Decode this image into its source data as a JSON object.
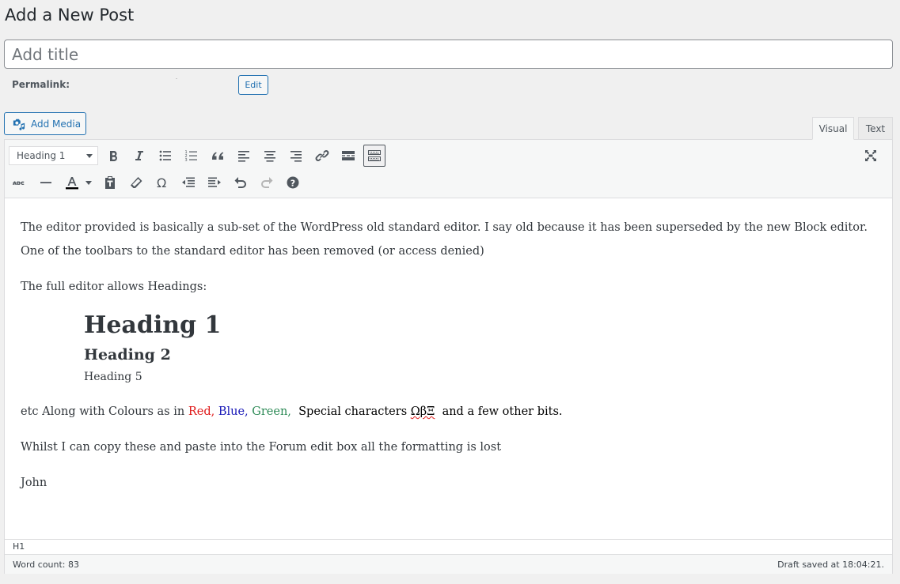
{
  "page": {
    "title": "Add a New Post"
  },
  "title_field": {
    "placeholder": "Add title",
    "value": ""
  },
  "permalink": {
    "label": "Permalink:",
    "edit_label": "Edit"
  },
  "media": {
    "add_media_label": "Add Media",
    "icon": "add-media-icon"
  },
  "editor_tabs": [
    {
      "label": "Visual",
      "active": true
    },
    {
      "label": "Text",
      "active": false
    }
  ],
  "toolbar": {
    "format_select": {
      "value": "Heading 1"
    },
    "row1": [
      {
        "name": "bold",
        "icon": "bold-icon"
      },
      {
        "name": "italic",
        "icon": "italic-icon"
      },
      {
        "name": "bulleted-list",
        "icon": "bulleted-list-icon"
      },
      {
        "name": "numbered-list",
        "icon": "numbered-list-icon"
      },
      {
        "name": "blockquote",
        "icon": "blockquote-icon"
      },
      {
        "name": "align-left",
        "icon": "align-left-icon"
      },
      {
        "name": "align-center",
        "icon": "align-center-icon"
      },
      {
        "name": "align-right",
        "icon": "align-right-icon"
      },
      {
        "name": "insert-link",
        "icon": "link-icon"
      },
      {
        "name": "read-more",
        "icon": "read-more-icon"
      },
      {
        "name": "toolbar-toggle",
        "icon": "keyboard-icon",
        "active": true
      }
    ],
    "row2": [
      {
        "name": "strikethrough",
        "icon": "strikethrough-icon"
      },
      {
        "name": "horizontal-line",
        "icon": "horizontal-line-icon"
      },
      {
        "name": "text-color",
        "icon": "text-color-icon"
      },
      {
        "name": "text-color-dropdown",
        "icon": "caret-down-icon"
      },
      {
        "name": "paste-as-text",
        "icon": "paste-text-icon"
      },
      {
        "name": "clear-formatting",
        "icon": "eraser-icon"
      },
      {
        "name": "special-character",
        "icon": "omega-icon"
      },
      {
        "name": "decrease-indent",
        "icon": "outdent-icon"
      },
      {
        "name": "increase-indent",
        "icon": "indent-icon"
      },
      {
        "name": "undo",
        "icon": "undo-icon"
      },
      {
        "name": "redo",
        "icon": "redo-icon",
        "disabled": true
      },
      {
        "name": "keyboard-shortcuts",
        "icon": "help-icon"
      }
    ],
    "fullscreen": {
      "icon": "fullscreen-icon"
    }
  },
  "content": {
    "paragraph1": "The editor provided is basically a sub-set of the WordPress old standard editor. I say old because it has been superseded by the new Block editor. One of the toolbars to the standard editor has been removed (or access denied)",
    "paragraph2": "The full editor allows Headings:",
    "heading1": "Heading 1",
    "heading2": "Heading 2",
    "heading5": "Heading 5",
    "paragraph3": {
      "prefix": "etc Along with Colours as in ",
      "red": "Red,",
      "blue": "Blue,",
      "green": "Green,",
      "special_prefix": "Special characters ",
      "special_chars": "ΩβΞ",
      "suffix": " and a few other bits."
    },
    "paragraph4": "Whilst I can copy these and paste into the Forum edit box all the formatting is lost",
    "paragraph5": "John"
  },
  "colors": {
    "red": "#e01b1b",
    "blue": "#1a1ab8",
    "green": "#2e8b57",
    "accent": "#2271b1"
  },
  "path_bar": {
    "value": "H1"
  },
  "status_bar": {
    "word_count": "Word count: 83",
    "draft_status": "Draft saved at 18:04:21."
  }
}
